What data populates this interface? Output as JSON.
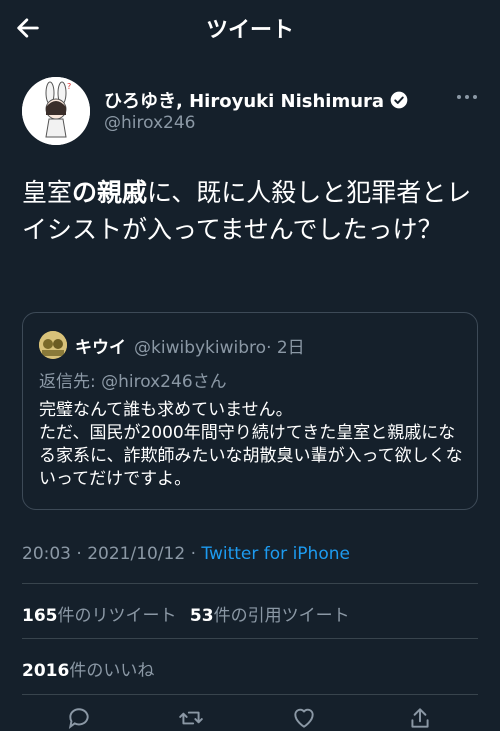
{
  "header": {
    "title": "ツイート"
  },
  "author": {
    "name": "ひろゆき, Hiroyuki Nishimura",
    "handle": "@hirox246"
  },
  "tweet": {
    "text_part1": "皇室",
    "text_bold1": "の親戚",
    "text_part2": "に、既に人殺しと犯罪者とレイシストが入ってませんでしたっけ？"
  },
  "quoted": {
    "name": "キウイ",
    "handle": "@kiwibykiwibro",
    "time": "· 2日",
    "reply_to": "返信先: @hirox246さん",
    "text": "完璧なんて誰も求めていません。\nただ、国民が2000年間守り続けてきた皇室と親戚になる家系に、詐欺師みたいな胡散臭い輩が入って欲しくないってだけですよ。"
  },
  "meta": {
    "time": "20:03 · 2021/10/12 · ",
    "source": "Twitter for iPhone"
  },
  "stats": {
    "retweets_count": "165",
    "retweets_label": "件のリツイート",
    "quotes_count": "53",
    "quotes_label": "件の引用ツイート",
    "likes_count": "2016",
    "likes_label": "件のいいね"
  },
  "icons": {
    "back": "back-arrow-icon",
    "verified": "verified-badge-icon",
    "more": "more-icon",
    "reply": "reply-icon",
    "retweet": "retweet-icon",
    "like": "heart-icon",
    "share": "share-icon"
  },
  "colors": {
    "background": "#15202b",
    "link": "#1d9bf0",
    "secondary": "#8b98a5"
  }
}
